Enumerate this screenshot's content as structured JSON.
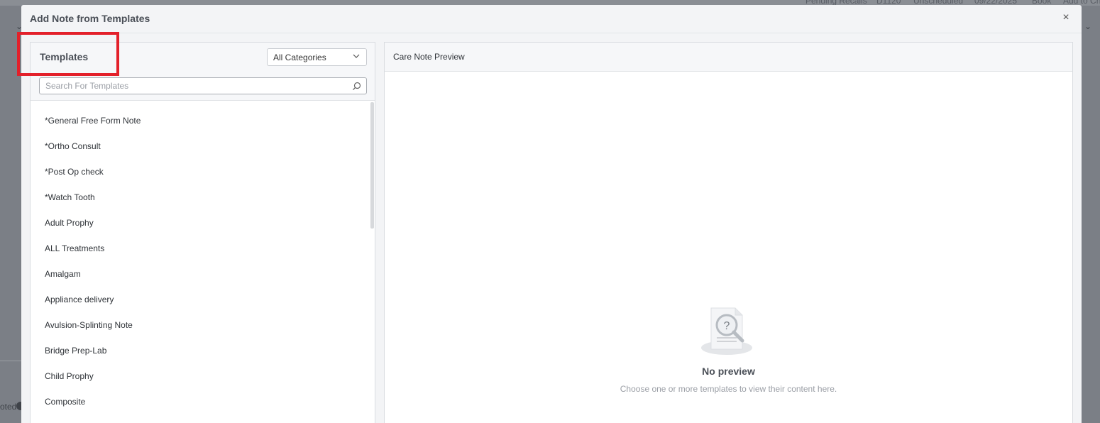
{
  "background": {
    "right_items": [
      "Pending Recalls",
      "D1120",
      "Unscheduled",
      "09/22/2025",
      "Book",
      "Add to Ch"
    ],
    "left_text": "oted"
  },
  "modal": {
    "title": "Add Note from Templates",
    "close_label": "×"
  },
  "templates": {
    "title": "Templates",
    "category_select": "All Categories",
    "search_placeholder": "Search For Templates",
    "items": [
      "*General Free Form Note",
      "*Ortho Consult",
      "*Post Op check",
      "*Watch Tooth",
      "Adult Prophy",
      "ALL Treatments",
      "Amalgam",
      "Appliance delivery",
      "Avulsion-Splinting Note",
      "Bridge Prep-Lab",
      "Child Prophy",
      "Composite"
    ]
  },
  "preview": {
    "title": "Care Note Preview",
    "empty_title": "No preview",
    "empty_description": "Choose one or more templates to view their content here."
  },
  "colors": {
    "highlight": "#e3202a",
    "overlay": "#7b7f86"
  }
}
